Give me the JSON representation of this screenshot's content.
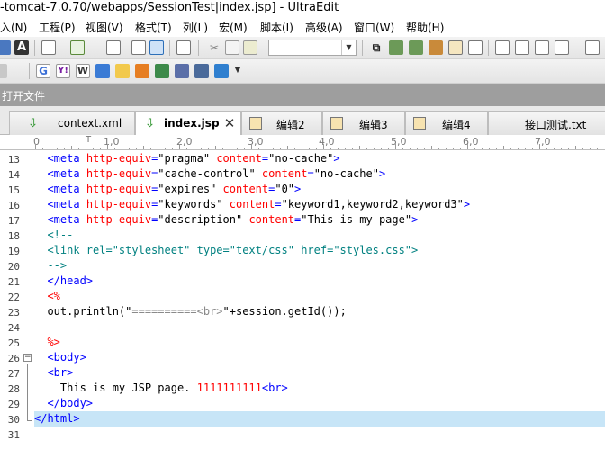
{
  "window": {
    "title": "-tomcat-7.0.70/webapps/SessionTest|index.jsp] - UltraEdit"
  },
  "menu": [
    "入(N)",
    "工程(P)",
    "视图(V)",
    "格式(T)",
    "列(L)",
    "宏(M)",
    "脚本(I)",
    "高级(A)",
    "窗口(W)",
    "帮助(H)"
  ],
  "open_file_label": "打开文件",
  "tabs": [
    {
      "label": "context.xml",
      "icon": "arrow-down-icon",
      "active": false
    },
    {
      "label": "index.jsp",
      "icon": "arrow-down-icon",
      "active": true
    },
    {
      "label": "编辑2",
      "icon": "edit-icon",
      "active": false
    },
    {
      "label": "编辑3",
      "icon": "edit-icon",
      "active": false
    },
    {
      "label": "编辑4",
      "icon": "edit-icon",
      "active": false
    },
    {
      "label": "接口测试.txt",
      "icon": "",
      "active": false
    }
  ],
  "ruler": [
    "0",
    "1,0",
    "2,0",
    "3,0",
    "4,0",
    "5,0",
    "6,0",
    "7,0"
  ],
  "line_numbers": [
    "13",
    "14",
    "15",
    "16",
    "17",
    "18",
    "19",
    "20",
    "21",
    "22",
    "23",
    "24",
    "25",
    "26",
    "27",
    "28",
    "29",
    "30",
    "31"
  ],
  "code": {
    "l13": {
      "indent": "  ",
      "tag_open": "<meta ",
      "a1": "http-equiv",
      "eq1": "=",
      "v1": "\"pragma\"",
      "a2": " content",
      "eq2": "=",
      "v2": "\"no-cache\"",
      "close": ">"
    },
    "l14": {
      "indent": "  ",
      "tag_open": "<meta ",
      "a1": "http-equiv",
      "eq1": "=",
      "v1": "\"cache-control\"",
      "a2": " content",
      "eq2": "=",
      "v2": "\"no-cache\"",
      "close": ">"
    },
    "l15": {
      "indent": "  ",
      "tag_open": "<meta ",
      "a1": "http-equiv",
      "eq1": "=",
      "v1": "\"expires\"",
      "a2": " content",
      "eq2": "=",
      "v2": "\"0\"",
      "close": ">"
    },
    "l16": {
      "indent": "  ",
      "tag_open": "<meta ",
      "a1": "http-equiv",
      "eq1": "=",
      "v1": "\"keywords\"",
      "a2": " content",
      "eq2": "=",
      "v2": "\"keyword1,keyword2,keyword3\"",
      "close": ">"
    },
    "l17": {
      "indent": "  ",
      "tag_open": "<meta ",
      "a1": "http-equiv",
      "eq1": "=",
      "v1": "\"description\"",
      "a2": " content",
      "eq2": "=",
      "v2": "\"This is my page\"",
      "close": ">"
    },
    "l18": "  <!--",
    "l19": "  <link rel=\"stylesheet\" type=\"text/css\" href=\"styles.css\">",
    "l20": "  -->",
    "l21": "  </head>",
    "l22": "  <%",
    "l23a": "  out.println(\"",
    "l23b": "==========<br>",
    "l23c": "\"+session.getId());",
    "l24": "",
    "l25": "  %>",
    "l26": "  <body>",
    "l27": "  <br>",
    "l28a": "    This is my JSP page. ",
    "l28b": "1111111111",
    "l28c": "<br>",
    "l29": "  </body>",
    "l30": "</html>",
    "l31": ""
  },
  "colors": {
    "tag": "#0000ff",
    "attr": "#ff0000",
    "comment": "#008080",
    "highlight": "#c7e5f7"
  }
}
